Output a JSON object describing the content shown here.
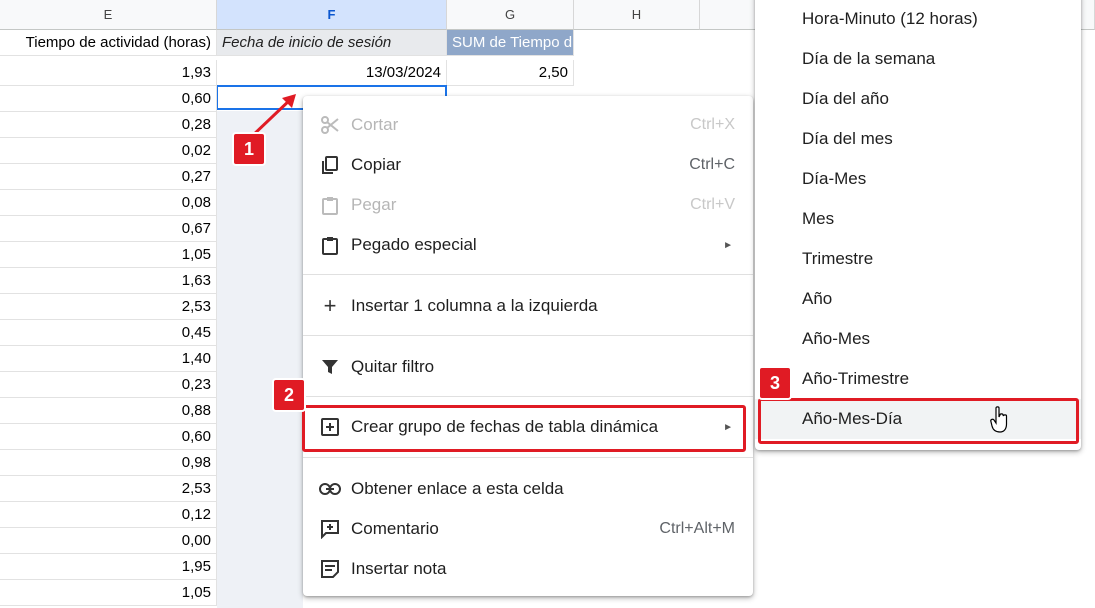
{
  "columns": {
    "e": "E",
    "f": "F",
    "g": "G",
    "h": "H"
  },
  "headers": {
    "e": "Tiempo de actividad (horas)",
    "f": "Fecha de inicio de sesión",
    "g": "SUM de Tiempo d"
  },
  "row1": {
    "f": "13/03/2024",
    "g": "2,50"
  },
  "e_values": [
    "1,93",
    "0,60",
    "0,28",
    "0,02",
    "0,27",
    "0,08",
    "0,67",
    "1,05",
    "1,63",
    "2,53",
    "0,45",
    "1,40",
    "0,23",
    "0,88",
    "0,60",
    "0,98",
    "2,53",
    "0,12",
    "0,00",
    "1,95",
    "1,05"
  ],
  "context_menu": {
    "cut": {
      "label": "Cortar",
      "shortcut": "Ctrl+X"
    },
    "copy": {
      "label": "Copiar",
      "shortcut": "Ctrl+C"
    },
    "paste": {
      "label": "Pegar",
      "shortcut": "Ctrl+V"
    },
    "paste_special": {
      "label": "Pegado especial"
    },
    "insert_col": {
      "label": "Insertar 1 columna a la izquierda"
    },
    "remove_filter": {
      "label": "Quitar filtro"
    },
    "date_group": {
      "label": "Crear grupo de fechas de tabla dinámica"
    },
    "get_link": {
      "label": "Obtener enlace a esta celda"
    },
    "comment": {
      "label": "Comentario",
      "shortcut": "Ctrl+Alt+M"
    },
    "insert_note": {
      "label": "Insertar nota"
    }
  },
  "submenu": [
    "Hora-Minuto (12 horas)",
    "Día de la semana",
    "Día del año",
    "Día del mes",
    "Día-Mes",
    "Mes",
    "Trimestre",
    "Año",
    "Año-Mes",
    "Año-Trimestre",
    "Año-Mes-Día"
  ],
  "badges": {
    "b1": "1",
    "b2": "2",
    "b3": "3"
  },
  "colors": {
    "annotation": "#e01b24",
    "selection": "#1a73e8",
    "pivot_header": "#8fa7c9"
  }
}
